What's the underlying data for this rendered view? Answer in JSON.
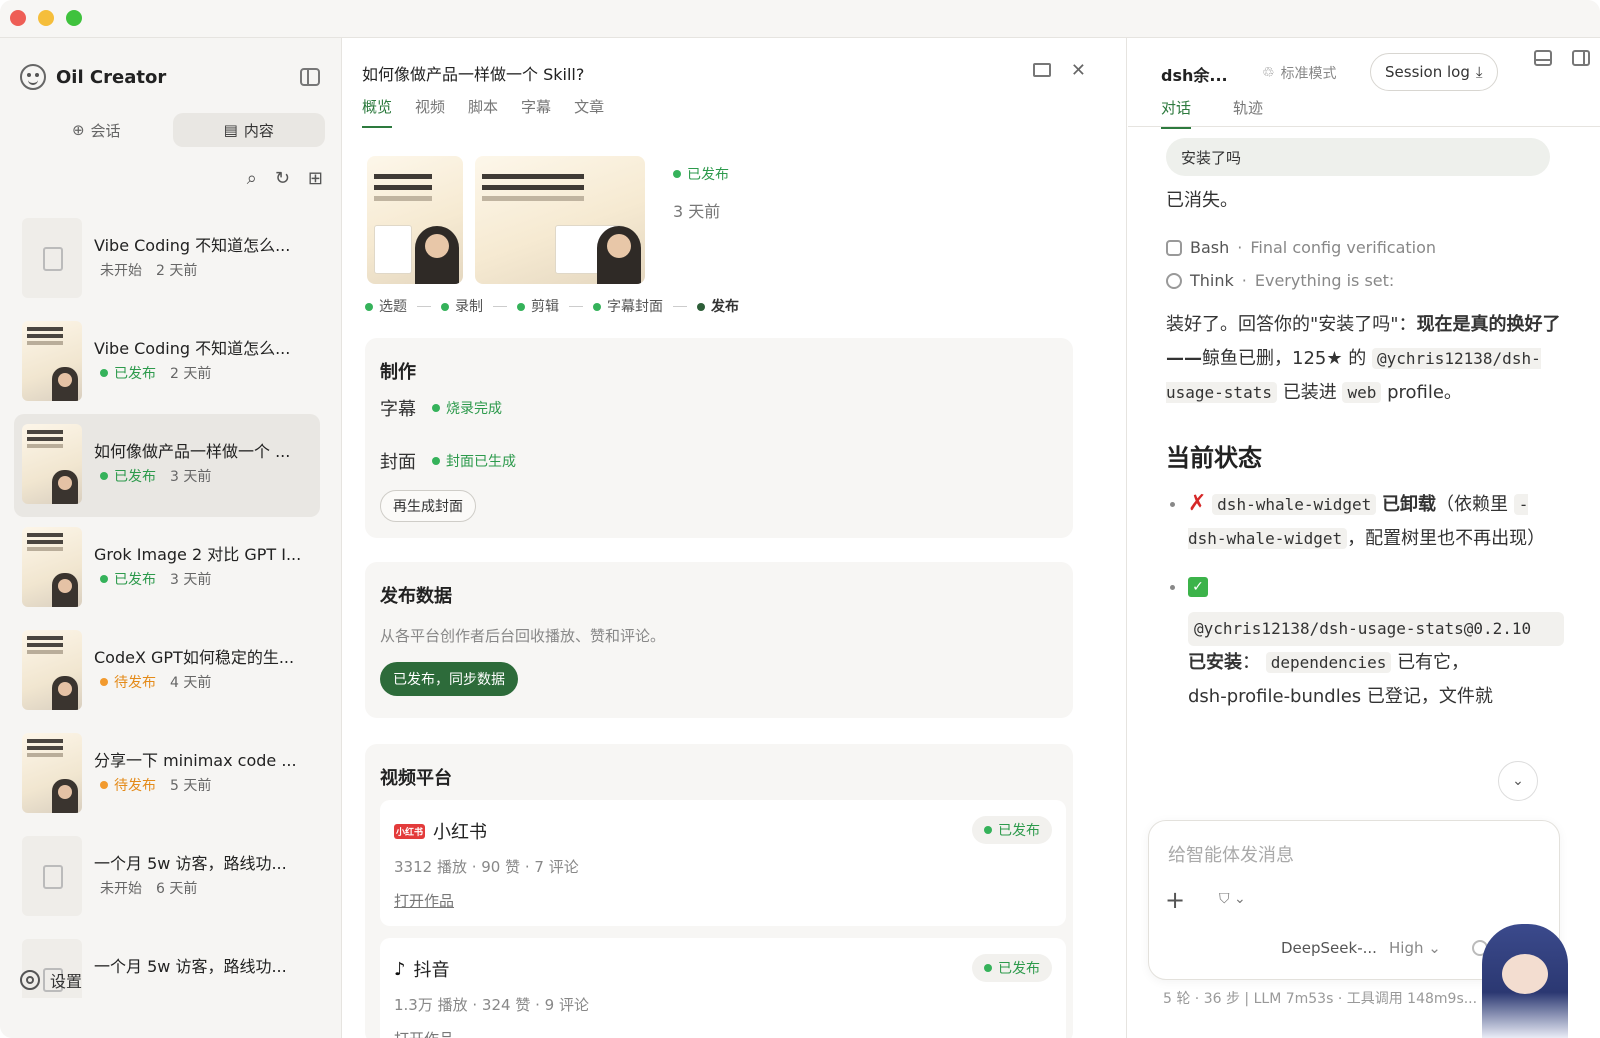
{
  "window": {
    "traffic_lights": [
      "close",
      "minimize",
      "zoom"
    ]
  },
  "sidebar": {
    "app_name": "Oil Creator",
    "segments": [
      {
        "label": "会话",
        "icon": "plus-circle-icon",
        "active": false
      },
      {
        "label": "内容",
        "icon": "document-icon",
        "active": true
      }
    ],
    "tools": [
      "search-icon",
      "refresh-icon",
      "new-content-icon"
    ],
    "items": [
      {
        "title": "Vibe Coding 不知道怎么...",
        "status": "未开始",
        "status_type": "none",
        "age": "2 天前",
        "thumb": "blank"
      },
      {
        "title": "Vibe Coding 不知道怎么...",
        "status": "已发布",
        "status_type": "published",
        "age": "2 天前",
        "thumb": "image"
      },
      {
        "title": "如何像做产品一样做一个 ...",
        "status": "已发布",
        "status_type": "published",
        "age": "3 天前",
        "thumb": "image",
        "selected": true
      },
      {
        "title": "Grok Image 2 对比 GPT I...",
        "status": "已发布",
        "status_type": "published",
        "age": "3 天前",
        "thumb": "image"
      },
      {
        "title": "CodeX GPT如何稳定的生...",
        "status": "待发布",
        "status_type": "pending",
        "age": "4 天前",
        "thumb": "image"
      },
      {
        "title": "分享一下 minimax code ...",
        "status": "待发布",
        "status_type": "pending",
        "age": "5 天前",
        "thumb": "image"
      },
      {
        "title": "一个月 5w 访客，路线功...",
        "status": "未开始",
        "status_type": "none",
        "age": "6 天前",
        "thumb": "blank"
      },
      {
        "title": "一个月 5w 访客，路线功...",
        "status": "",
        "status_type": "none",
        "age": "",
        "thumb": "blank"
      }
    ],
    "settings_label": "设置"
  },
  "detail": {
    "title": "如何像做产品一样做一个 Skill?",
    "tabs": [
      "概览",
      "视频",
      "脚本",
      "字幕",
      "文章"
    ],
    "active_tab": "概览",
    "publish_status": "已发布",
    "publish_age": "3 天前",
    "pipeline": [
      "选题",
      "录制",
      "剪辑",
      "字幕封面",
      "发布"
    ],
    "production": {
      "title": "制作",
      "subtitle_label": "字幕",
      "subtitle_status": "烧录完成",
      "cover_label": "封面",
      "cover_status": "封面已生成",
      "regen_button": "再生成封面"
    },
    "publish_data": {
      "title": "发布数据",
      "desc": "从各平台创作者后台回收播放、赞和评论。",
      "sync_button": "已发布，同步数据"
    },
    "platforms": {
      "title": "视频平台",
      "list": [
        {
          "name": "小红书",
          "logo_text": "小红书",
          "status": "已发布",
          "stats": "3312 播放 · 90 赞 · 7 评论",
          "link": "打开作品"
        },
        {
          "name": "抖音",
          "logo_text": "♪",
          "status": "已发布",
          "stats": "1.3万 播放 · 324 赞 · 9 评论",
          "link": "打开作品"
        }
      ]
    }
  },
  "agent": {
    "name": "dsh余...",
    "mode": "标准模式",
    "session_button": "Session log",
    "tabs": [
      "对话",
      "轨迹"
    ],
    "active_tab": "对话",
    "user_message": "安装了吗",
    "msg_removed": "已消失。",
    "tool_bash_name": "Bash",
    "tool_bash_desc": "Final config verification",
    "tool_think_name": "Think",
    "tool_think_desc": "Everything is set:",
    "reply_p1": "装好了。回答你的\"安装了吗\"：",
    "reply_p1_bold": "现在是真的换好了——",
    "reply_p1_rest": "鲸鱼已删，125★ 的",
    "reply_code1": "@ychris12138/dsh-usage-stats",
    "reply_p2": "已装进",
    "reply_code2": "web",
    "reply_p3": "profile。",
    "status_heading": "当前状态",
    "b1_code": "dsh-whale-widget",
    "b1_bold": "已卸载",
    "b1_rest1": "（依赖里",
    "b1_code2": "- dsh-whale-widget",
    "b1_rest2": "，配置树里也不再出现）",
    "b2_code": "@ychris12138/dsh-usage-stats@0.2.10",
    "b2_bold": "已安装",
    "b2_code2": "dependencies",
    "b2_rest": "已有它，",
    "b2_cut": "dsh-profile-bundles 已登记，文件就",
    "composer_placeholder": "给智能体发消息",
    "model": "DeepSeek-...",
    "effort": "High",
    "footer": "5 轮 · 36 步  |  LLM 7m53s · 工具调用 148m9s..."
  },
  "colors": {
    "accent": "#2d7a3e",
    "published": "#35b25a",
    "pending": "#f29a2e",
    "sync_button": "#2d6b3a",
    "error": "#d62828"
  }
}
